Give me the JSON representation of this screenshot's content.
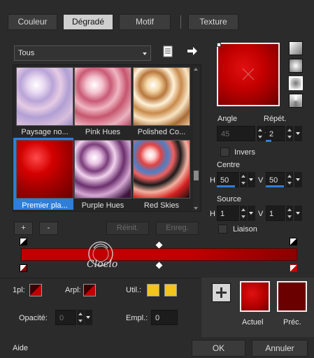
{
  "tabs": [
    {
      "label": "Couleur",
      "active": false
    },
    {
      "label": "Dégradé",
      "active": true
    },
    {
      "label": "Motif",
      "active": false
    },
    {
      "label": "Texture",
      "active": false
    }
  ],
  "category": {
    "selected": "Tous"
  },
  "gradients": [
    {
      "label": "Paysage no...",
      "selected": false
    },
    {
      "label": "Pink Hues",
      "selected": false
    },
    {
      "label": "Polished Co...",
      "selected": false
    },
    {
      "label": "Premier pla...",
      "selected": true
    },
    {
      "label": "Purple Hues",
      "selected": false
    },
    {
      "label": "Red Skies",
      "selected": false
    }
  ],
  "list_buttons": {
    "add": "+",
    "remove": "-",
    "reset": "Réinit.",
    "save": "Enreg."
  },
  "angle": {
    "label": "Angle",
    "value": "45"
  },
  "repeat": {
    "label": "Répét.",
    "value": "2"
  },
  "invert": {
    "label": "Invers",
    "checked": false
  },
  "center": {
    "label": "Centre",
    "h_label": "H",
    "h_value": "50",
    "v_label": "V",
    "v_value": "50"
  },
  "source": {
    "label": "Source",
    "h_label": "H",
    "h_value": "1",
    "v_label": "V",
    "v_value": "1"
  },
  "link": {
    "label": "Liaison",
    "checked": false
  },
  "stops": {
    "fg_label": "1pl:",
    "bg_label": "Arpl:",
    "user_label": "Util.:",
    "opacity_label": "Opacité:",
    "opacity_value": "0",
    "location_label": "Empl.:",
    "location_value": "0"
  },
  "watermark": {
    "text": "Cloclo"
  },
  "previews": {
    "current_label": "Actuel",
    "previous_label": "Préc."
  },
  "footer": {
    "help": "Aide",
    "ok": "OK",
    "cancel": "Annuler"
  },
  "colors": {
    "accent": "#2f7ed8",
    "gradient_red": "#c00000",
    "gradient_dark": "#6a0000",
    "user_yellow": "#f2c41c"
  }
}
